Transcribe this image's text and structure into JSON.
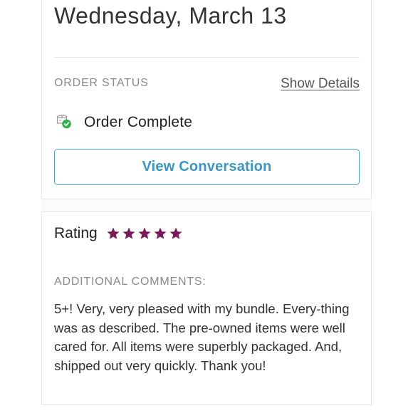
{
  "order": {
    "date": "Wednesday, March 13",
    "status_heading": "ORDER STATUS",
    "show_details_label": "Show Details",
    "status_text": "Order Complete",
    "view_conversation_label": "View Conversation"
  },
  "review": {
    "rating_label": "Rating",
    "rating_value": 5,
    "rating_max": 5,
    "star_color": "#7b1c5a",
    "comments_heading": "ADDITIONAL COMMENTS:",
    "comments_text": "5+! Very, very pleased with my bundle. Every-thing was as described. The pre-owned items were well cared for. All items were superbly packaged. And, shipped out very quickly. Thank you!"
  },
  "colors": {
    "accent_blue": "#3a97c8",
    "success_green": "#2db34a"
  }
}
